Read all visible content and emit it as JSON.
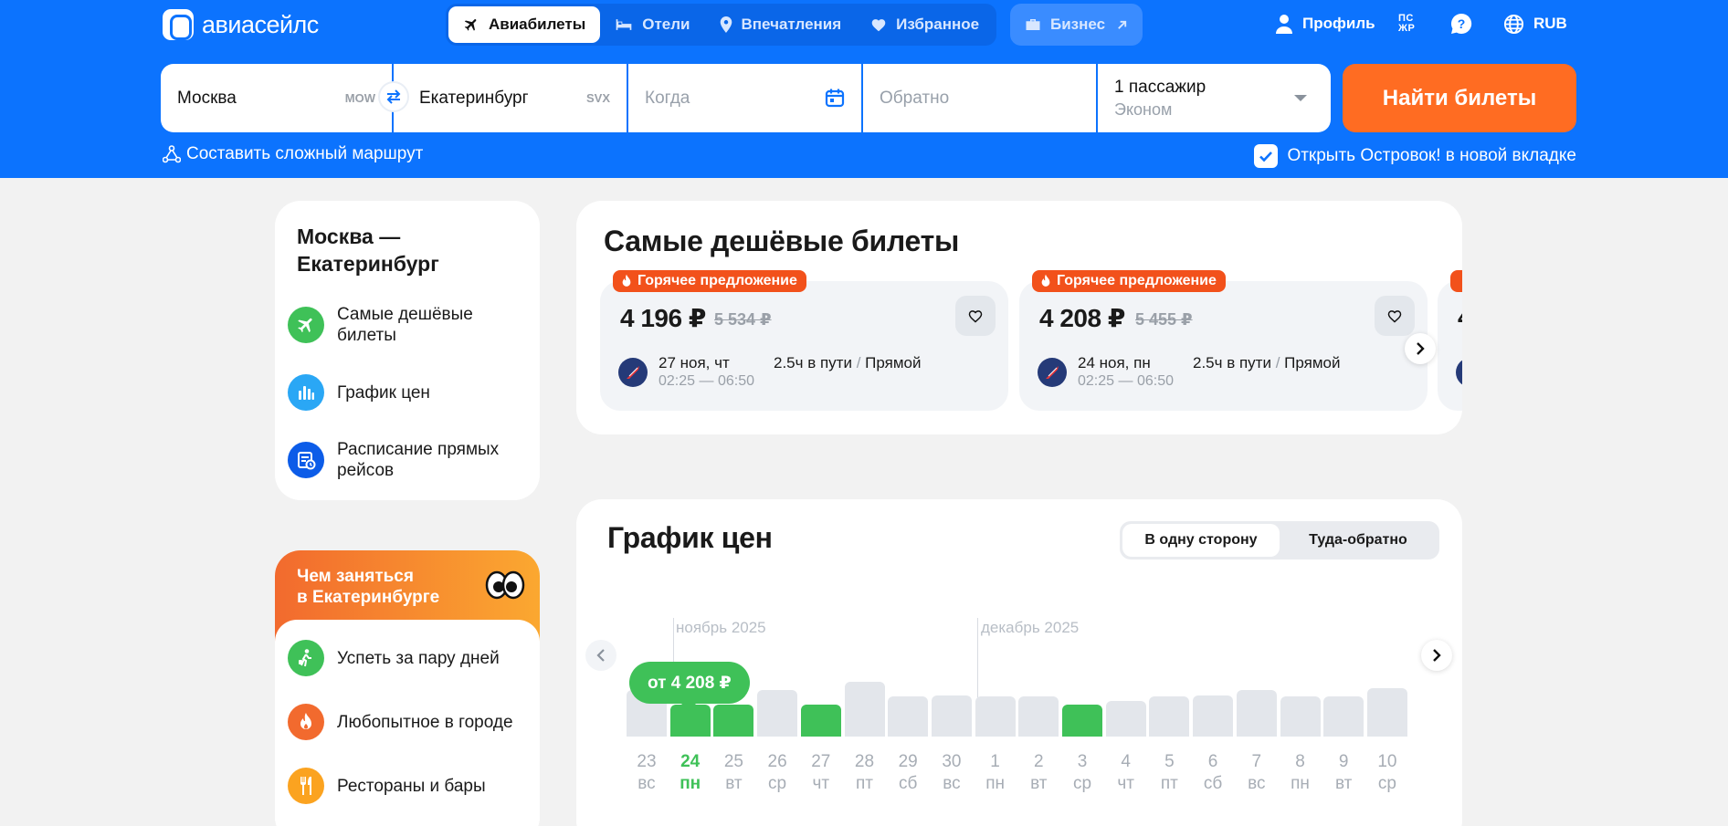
{
  "brand": {
    "name": "авиасейлс"
  },
  "nav": {
    "tabs": [
      {
        "label": "Авиабилеты",
        "icon": "plane-icon",
        "active": true
      },
      {
        "label": "Отели",
        "icon": "bed-icon",
        "active": false
      },
      {
        "label": "Впечатления",
        "icon": "pin-icon",
        "active": false
      },
      {
        "label": "Избранное",
        "icon": "heart-icon",
        "active": false
      }
    ],
    "business": "Бизнес"
  },
  "header_right": {
    "profile": "Профиль",
    "psjr_line1": "ПС",
    "psjr_line2": "ЖР",
    "currency": "RUB"
  },
  "search": {
    "from": "Москва",
    "from_code": "MOW",
    "to": "Екатеринбург",
    "to_code": "SVX",
    "when_placeholder": "Когда",
    "back_placeholder": "Обратно",
    "passengers": "1 пассажир",
    "class": "Эконом",
    "find_button": "Найти билеты",
    "complex_route": "Составить сложный маршрут",
    "open_ostrovok": "Открыть Островок! в новой вкладке"
  },
  "sidebar": {
    "title": "Москва — Екатеринбург",
    "items": [
      {
        "label": "Самые дешёвые билеты",
        "icon": "plane-icon",
        "color": "#3fc158"
      },
      {
        "label": "График цен",
        "icon": "bar-chart-icon",
        "color": "#2aa7f5"
      },
      {
        "label": "Расписание прямых рейсов",
        "icon": "schedule-icon",
        "color": "#0c5ce8"
      }
    ]
  },
  "activities": {
    "title_line1": "Чем заняться",
    "title_line2": "в Екатеринбурге",
    "items": [
      {
        "label": "Успеть за пару дней",
        "icon": "walker-icon",
        "color": "#3fc158"
      },
      {
        "label": "Любопытное в городе",
        "icon": "fire-icon",
        "color": "#f26a2e"
      },
      {
        "label": "Рестораны и бары",
        "icon": "cutlery-icon",
        "color": "#fba320"
      }
    ]
  },
  "cheapest": {
    "title": "Самые дешёвые билеты",
    "hot_label": "Горячее предложение",
    "tickets": [
      {
        "price": "4 196 ₽",
        "old_price": "5 534 ₽",
        "date": "27 ноя, чт",
        "dep": "02:25",
        "arr": "06:50",
        "duration": "2.5ч в пути",
        "type": "Прямой"
      },
      {
        "price": "4 208 ₽",
        "old_price": "5 455 ₽",
        "date": "24 ноя, пн",
        "dep": "02:25",
        "arr": "06:50",
        "duration": "2.5ч в пути",
        "type": "Прямой"
      }
    ],
    "peek_price": "4"
  },
  "price_chart": {
    "title": "График цен",
    "toggle": [
      "В одну сторону",
      "Туда-обратно"
    ],
    "active_toggle": 0,
    "months": [
      "ноябрь 2025",
      "декабрь 2025"
    ],
    "bubble": "от 4 208 ₽",
    "selected_index": 1
  },
  "chart_data": {
    "type": "bar",
    "categories": [
      "23",
      "24",
      "25",
      "26",
      "27",
      "28",
      "29",
      "30",
      "1",
      "2",
      "3",
      "4",
      "5",
      "6",
      "7",
      "8",
      "9",
      "10"
    ],
    "weekdays": [
      "вс",
      "пн",
      "вт",
      "ср",
      "чт",
      "пт",
      "сб",
      "вс",
      "пн",
      "вт",
      "ср",
      "чт",
      "пт",
      "сб",
      "вс",
      "пн",
      "вт",
      "ср"
    ],
    "values": [
      44,
      30,
      30,
      44,
      30,
      52,
      38,
      39,
      38,
      38,
      30,
      34,
      38,
      39,
      44,
      38,
      38,
      46
    ],
    "highlighted": [
      false,
      true,
      true,
      false,
      true,
      false,
      false,
      false,
      false,
      false,
      true,
      false,
      false,
      false,
      false,
      false,
      false,
      false
    ],
    "min_price": "4 208 ₽",
    "colors": {
      "cheap": "#3fc158",
      "regular": "#e3e6eb"
    }
  }
}
